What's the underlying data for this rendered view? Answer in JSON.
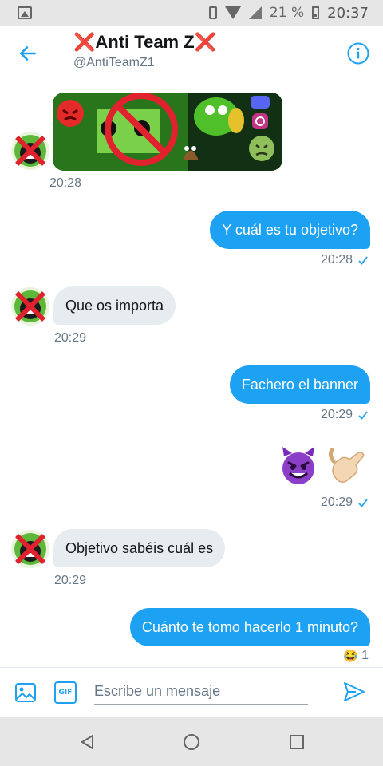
{
  "status_bar": {
    "battery": "21 %",
    "time": "20:37"
  },
  "header": {
    "title_mark_left": "❌",
    "title_text": "Anti Team Z",
    "title_mark_right": "❌",
    "handle": "@AntiTeamZ1"
  },
  "messages": [
    {
      "id": "banner",
      "direction": "in",
      "type": "image",
      "time": "20:28"
    },
    {
      "id": "m1",
      "direction": "out",
      "text": "Y cuál es tu objetivo?",
      "time": "20:28",
      "read": true
    },
    {
      "id": "m2",
      "direction": "in",
      "text": "Que os importa",
      "time": "20:29"
    },
    {
      "id": "m3",
      "direction": "out",
      "text": "Fachero el banner",
      "time": "20:29",
      "read": true
    },
    {
      "id": "m4",
      "direction": "out",
      "emojis": [
        "😈",
        "🤙"
      ],
      "time": "20:29",
      "read": true
    },
    {
      "id": "m5",
      "direction": "in",
      "text": "Objetivo sabéis cuál es",
      "time": "20:29"
    },
    {
      "id": "m6",
      "direction": "out",
      "text": "Cuánto te tomo hacerlo 1 minuto?",
      "reaction_emoji": "😂",
      "reaction_count": "1"
    }
  ],
  "composer": {
    "gif_label": "GIF",
    "placeholder": "Escribe un mensaje"
  },
  "colors": {
    "accent": "#1da1f2",
    "bubble_in": "#e6ecf0",
    "red_mark": "#e0212e"
  },
  "icons": {
    "back": "arrow-left-icon",
    "info": "info-icon",
    "image": "image-icon",
    "gif": "gif-icon",
    "send": "send-icon",
    "read": "check-icon",
    "nav_back": "triangle-back-icon",
    "nav_home": "circle-home-icon",
    "nav_recents": "square-recents-icon"
  }
}
